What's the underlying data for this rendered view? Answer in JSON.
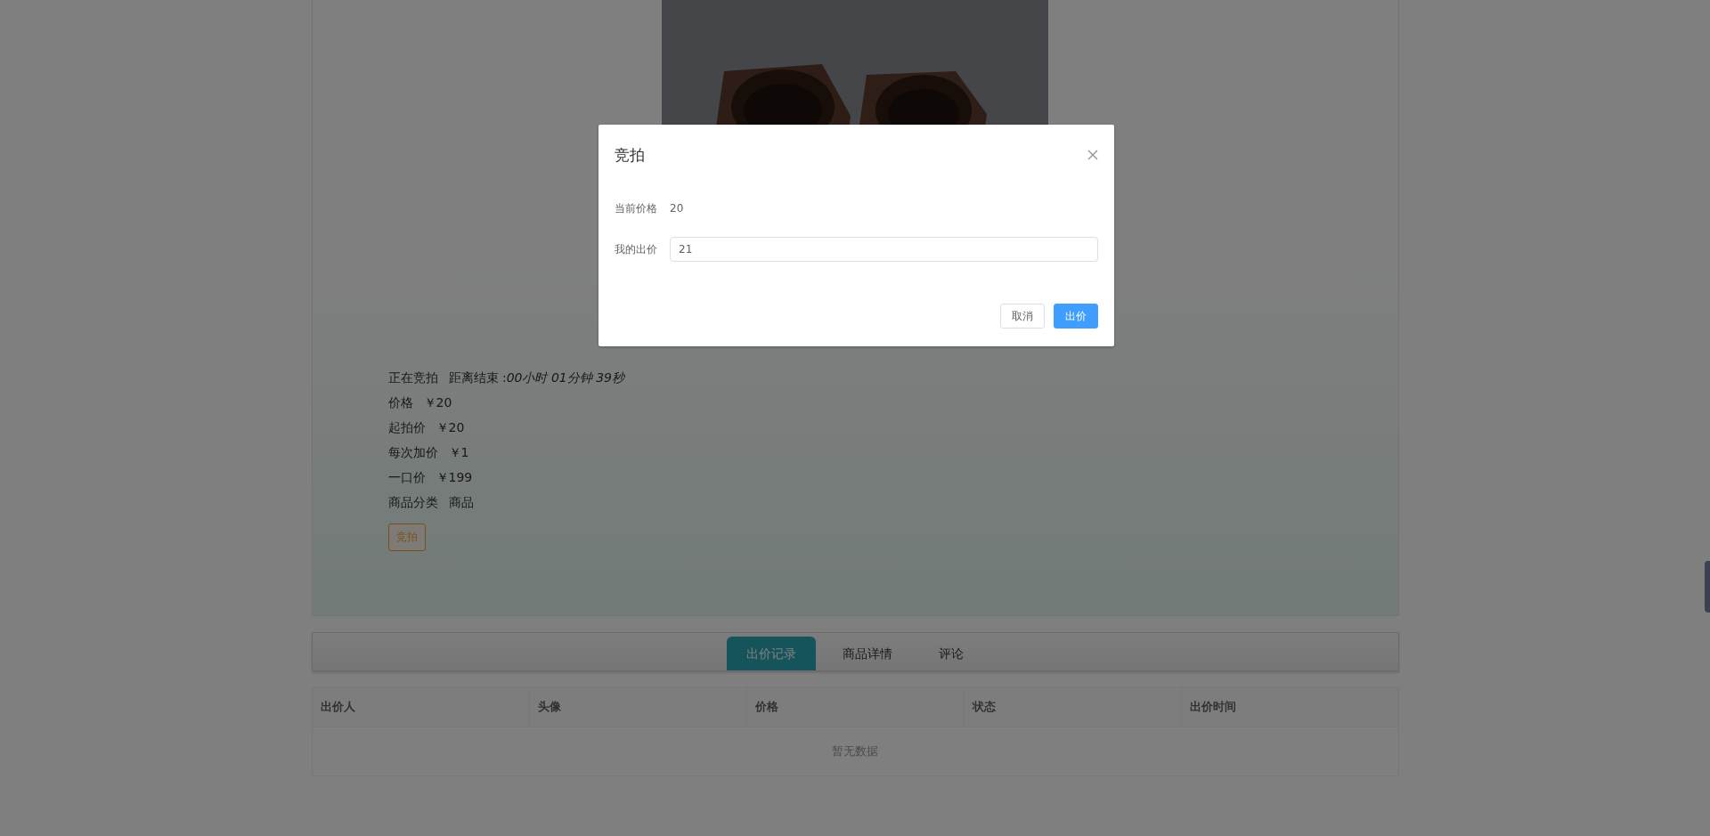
{
  "product": {
    "status": "正在竞拍",
    "countdown": "距离结束 :*00小时 01分钟 39秒*",
    "details": [
      {
        "label": "价格",
        "value": "￥20"
      },
      {
        "label": "起拍价",
        "value": "￥20"
      },
      {
        "label": "每次加价",
        "value": "￥1"
      },
      {
        "label": "一口价",
        "value": "￥199"
      },
      {
        "label": "商品分类",
        "value": "商品"
      }
    ],
    "bid_button": "竞拍"
  },
  "tabs": [
    {
      "label": "出价记录",
      "selected": true
    },
    {
      "label": "商品详情",
      "selected": false
    },
    {
      "label": "评论",
      "selected": false
    }
  ],
  "table": {
    "columns": [
      "出价人",
      "头像",
      "价格",
      "状态",
      "出价时间"
    ],
    "empty_text": "暂无数据"
  },
  "dialog": {
    "title": "竞拍",
    "fields": [
      {
        "kind": "text",
        "label": "当前价格",
        "value": "20"
      },
      {
        "kind": "input",
        "label": "我的出价",
        "value": "21"
      }
    ],
    "buttons": [
      {
        "kind": "default",
        "label": "取消"
      },
      {
        "kind": "primary",
        "label": "出价"
      }
    ]
  }
}
